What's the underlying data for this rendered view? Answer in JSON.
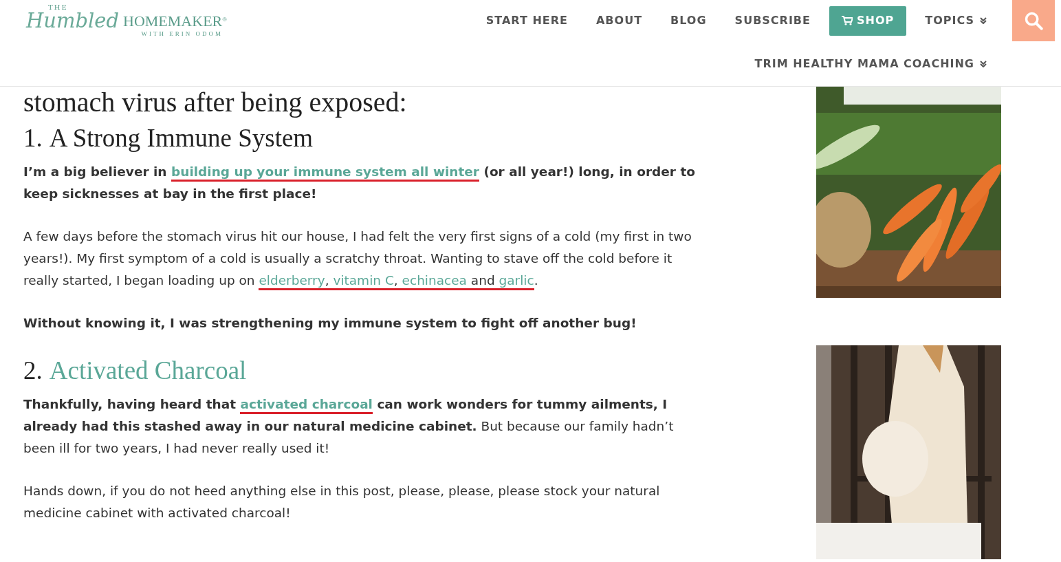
{
  "header": {
    "logo": {
      "the": "THE",
      "script": "Humbled",
      "word": "HOMEMAKER",
      "mark": "®",
      "tagline": "WITH ERIN ODOM"
    },
    "nav": [
      {
        "label": "START HERE",
        "kind": "link"
      },
      {
        "label": "ABOUT",
        "kind": "link"
      },
      {
        "label": "BLOG",
        "kind": "link"
      },
      {
        "label": "SUBSCRIBE",
        "kind": "link"
      },
      {
        "label": "SHOP",
        "kind": "button"
      },
      {
        "label": "TOPICS",
        "kind": "dropdown"
      }
    ],
    "nav_second_row": [
      {
        "label": "TRIM HEALTHY MAMA COACHING",
        "kind": "dropdown"
      }
    ]
  },
  "article": [
    {
      "kind": "heading_large",
      "title": "stomach virus after being exposed:",
      "title_link": false
    },
    {
      "kind": "heading",
      "number": "1.",
      "title": "A Strong Immune System",
      "title_link": false
    },
    {
      "kind": "paragraph",
      "segments": [
        {
          "text": "I’m a big believer in ",
          "bold": true,
          "link": false,
          "underlined": false
        },
        {
          "text": "building up your immune system all winter",
          "bold": true,
          "link": true,
          "underlined": true
        },
        {
          "text": " (or all year!) long, in order to keep sicknesses at bay in the first place!",
          "bold": true,
          "link": false,
          "underlined": false
        }
      ]
    },
    {
      "kind": "paragraph",
      "segments": [
        {
          "text": "A few days before the stomach virus hit our house, I had felt the very first signs of a cold (my first in two years!). My first symptom of a cold is usually a scratchy throat. Wanting to stave off the cold before it really started, I began loading up on ",
          "bold": false,
          "link": false,
          "underlined": false
        },
        {
          "text": "elderberry",
          "bold": false,
          "link": true,
          "underlined": true
        },
        {
          "text": ", ",
          "bold": false,
          "link": false,
          "underlined": true
        },
        {
          "text": "vitamin C",
          "bold": false,
          "link": true,
          "underlined": true
        },
        {
          "text": ", ",
          "bold": false,
          "link": false,
          "underlined": true
        },
        {
          "text": "echinacea",
          "bold": false,
          "link": true,
          "underlined": true
        },
        {
          "text": " and ",
          "bold": false,
          "link": false,
          "underlined": true
        },
        {
          "text": "garlic",
          "bold": false,
          "link": true,
          "underlined": true
        },
        {
          "text": ".",
          "bold": false,
          "link": false,
          "underlined": false
        }
      ]
    },
    {
      "kind": "paragraph",
      "segments": [
        {
          "text": "Without knowing it, I was strengthening my immune system to fight off another bug!",
          "bold": true,
          "link": false,
          "underlined": false
        }
      ]
    },
    {
      "kind": "heading",
      "number": "2.",
      "title": "Activated Charcoal",
      "title_link": true
    },
    {
      "kind": "paragraph",
      "segments": [
        {
          "text": "Thankfully, having heard that ",
          "bold": true,
          "link": false,
          "underlined": false
        },
        {
          "text": "activated charcoal",
          "bold": true,
          "link": true,
          "underlined": true
        },
        {
          "text": " can work wonders for tummy ailments, I already had this stashed away in our natural medicine cabinet.",
          "bold": true,
          "link": false,
          "underlined": false
        },
        {
          "text": " But because our family hadn’t been ill for two years, I had never really used it!",
          "bold": false,
          "link": false,
          "underlined": false
        }
      ]
    },
    {
      "kind": "paragraph",
      "segments": [
        {
          "text": "Hands down, if you do not heed anything else in this post, please, please, please stock your natural medicine cabinet with activated charcoal!",
          "bold": false,
          "link": false,
          "underlined": false
        }
      ]
    }
  ]
}
